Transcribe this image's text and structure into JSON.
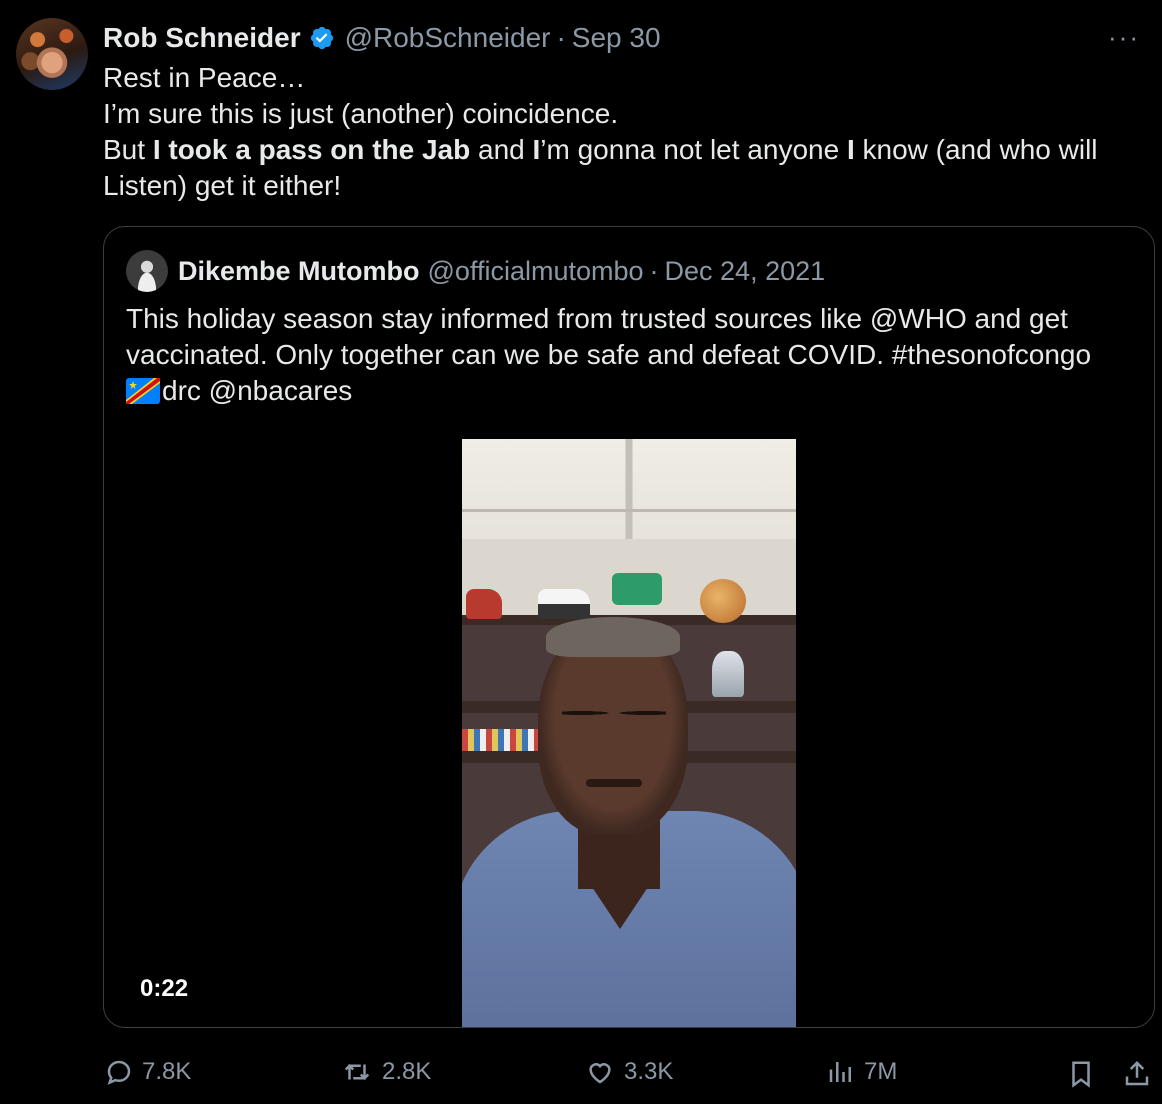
{
  "author": {
    "name": "Rob Schneider",
    "handle": "@RobSchneider",
    "separator": "·",
    "date": "Sep 30"
  },
  "more_label": "···",
  "body": {
    "line1": "Rest in Peace…",
    "line2": "I’m sure this is just (another) coincidence.",
    "line3_a": "But ",
    "line3_b": "I took a pass on the Jab",
    "line3_c": " and ",
    "line3_d": "I",
    "line3_e": "’m gonna not let anyone ",
    "line3_f": "I",
    "line3_g": " know (and who will Listen) get it either!"
  },
  "quote": {
    "name": "Dikembe Mutombo",
    "handle": "@officialmutombo",
    "separator": "·",
    "date": "Dec 24, 2021",
    "text1": "This holiday season stay informed from trusted sources like @WHO and get vaccinated. Only together can we be safe and defeat COVID. #thesonofcongo",
    "text2": "drc @nbacares",
    "video_duration": "0:22"
  },
  "actions": {
    "replies": "7.8K",
    "reposts": "2.8K",
    "likes": "3.3K",
    "views": "7M"
  },
  "colors": {
    "background": "#000000",
    "text": "#e7e9ea",
    "muted": "#8b98a5",
    "verified": "#1d9bf0",
    "border": "#3a3f44"
  },
  "icons": [
    "verified-badge-icon",
    "more-icon",
    "reply-icon",
    "repost-icon",
    "like-icon",
    "views-icon",
    "bookmark-icon",
    "share-icon",
    "drc-flag-icon"
  ]
}
